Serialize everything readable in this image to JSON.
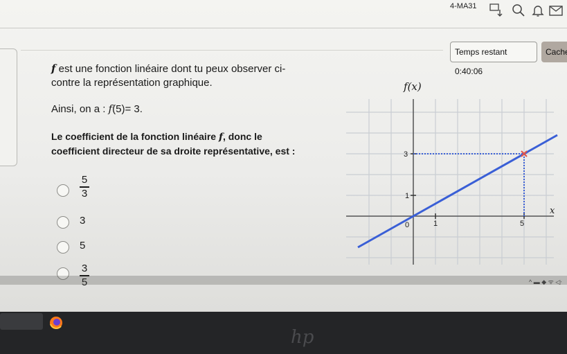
{
  "header": {
    "code": "4-MA31",
    "timer_label": "Temps restant",
    "timer_value": "0:40:06",
    "hide_label": "Cache"
  },
  "question": {
    "line1_fn": "f",
    "line1_rest": " est une fonction linéaire dont tu peux observer ci-",
    "line2": "contre la représentation graphique.",
    "ainsi_prefix": "Ainsi, on a : ",
    "ainsi_f": "f",
    "ainsi_arg": "(5)",
    "ainsi_eq": "= 3.",
    "ask1_a": "Le coefficient de la fonction linéaire ",
    "ask1_f": "f",
    "ask1_b": ", donc le",
    "ask2": "coefficient directeur de sa droite représentative, est :"
  },
  "options": [
    {
      "kind": "fraction",
      "num": "5",
      "den": "3"
    },
    {
      "kind": "text",
      "text": "3"
    },
    {
      "kind": "text",
      "text": "5"
    },
    {
      "kind": "fraction",
      "num": "3",
      "den": "5"
    }
  ],
  "graph": {
    "y_label": "f(x)",
    "x_label": "x",
    "origin_label": "0",
    "x_tick_1": "1",
    "x_tick_5": "5",
    "y_tick_1": "1",
    "y_tick_3": "3"
  },
  "chart_data": {
    "type": "line",
    "title": "",
    "xlabel": "x",
    "ylabel": "f(x)",
    "xlim": [
      -2.5,
      6.5
    ],
    "ylim": [
      -2,
      6
    ],
    "series": [
      {
        "x": [
          -2.5,
          6.5
        ],
        "y": [
          -1.5,
          3.9
        ]
      }
    ],
    "highlight_point": {
      "x": 5,
      "y": 3
    },
    "grid": true,
    "colors": {
      "line": "#3a5fd6",
      "guides": "#3a5fd6",
      "point": "#e0554a",
      "grid": "#c9cdd3"
    }
  },
  "taskbar": {
    "tray": "^ ▬ ◆ ᯤ ◁ᐧ",
    "brand": "hp"
  }
}
